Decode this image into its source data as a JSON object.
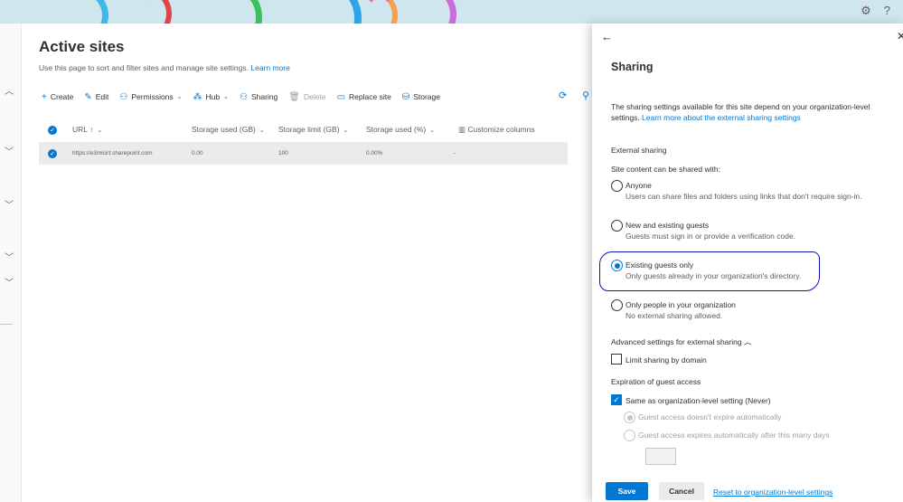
{
  "banner": {
    "settings_icon": "gear-icon",
    "help_icon": "question-icon",
    "help_glyph": "?"
  },
  "main": {
    "title": "Active sites",
    "description": "Use this page to sort and filter sites and manage site settings.",
    "learn_more": "Learn more",
    "commands": [
      {
        "label": "Create",
        "icon": "plus-icon"
      },
      {
        "label": "Edit",
        "icon": "pencil-icon"
      },
      {
        "label": "Permissions",
        "icon": "people-icon"
      },
      {
        "label": "Hub",
        "icon": "hub-icon"
      },
      {
        "label": "Sharing",
        "icon": "share-icon"
      },
      {
        "label": "Delete",
        "icon": "trash-icon"
      },
      {
        "label": "Replace site",
        "icon": "replace-icon"
      },
      {
        "label": "Storage",
        "icon": "storage-icon"
      }
    ],
    "table": {
      "columns": [
        "URL ↑",
        "Storage used (GB)",
        "Storage limit (GB)",
        "Storage used (%)",
        "Customize columns"
      ],
      "rows": [
        {
          "url": "https://e3micirt.sharepoint.com",
          "storage_used_gb": "0.00",
          "storage_limit_gb": "100",
          "storage_used_pct": "0.00%",
          "extra": "-"
        }
      ]
    }
  },
  "panel": {
    "title": "Sharing",
    "description": "The sharing settings available for this site depend on your organization-level settings.",
    "learn_link": "Learn more about the external sharing settings",
    "external_sharing_title": "External sharing",
    "shared_with_label": "Site content can be shared with:",
    "options": [
      {
        "label": "Anyone",
        "desc": "Users can share files and folders using links that don't require sign-in.",
        "selected": false
      },
      {
        "label": "New and existing guests",
        "desc": "Guests must sign in or provide a verification code.",
        "selected": false
      },
      {
        "label": "Existing guests only",
        "desc": "Only guests already in your organization's directory.",
        "selected": true
      },
      {
        "label": "Only people in your organization",
        "desc": "No external sharing allowed.",
        "selected": false
      }
    ],
    "advanced_title": "Advanced settings for external sharing",
    "limit_domain_label": "Limit sharing by domain",
    "limit_domain_checked": false,
    "expiration_title": "Expiration of guest access",
    "same_as_org_label": "Same as organization-level setting (Never)",
    "same_as_org_checked": true,
    "expire_options": [
      {
        "label": "Guest access doesn't expire automatically",
        "selected": true
      },
      {
        "label": "Guest access expires automatically after this many days",
        "selected": false
      }
    ],
    "days_value": "",
    "save_label": "Save",
    "cancel_label": "Cancel",
    "reset_label": "Reset to organization-level settings"
  },
  "colors": {
    "accent": "#0078d4",
    "highlight_ink": "#1010b8"
  }
}
